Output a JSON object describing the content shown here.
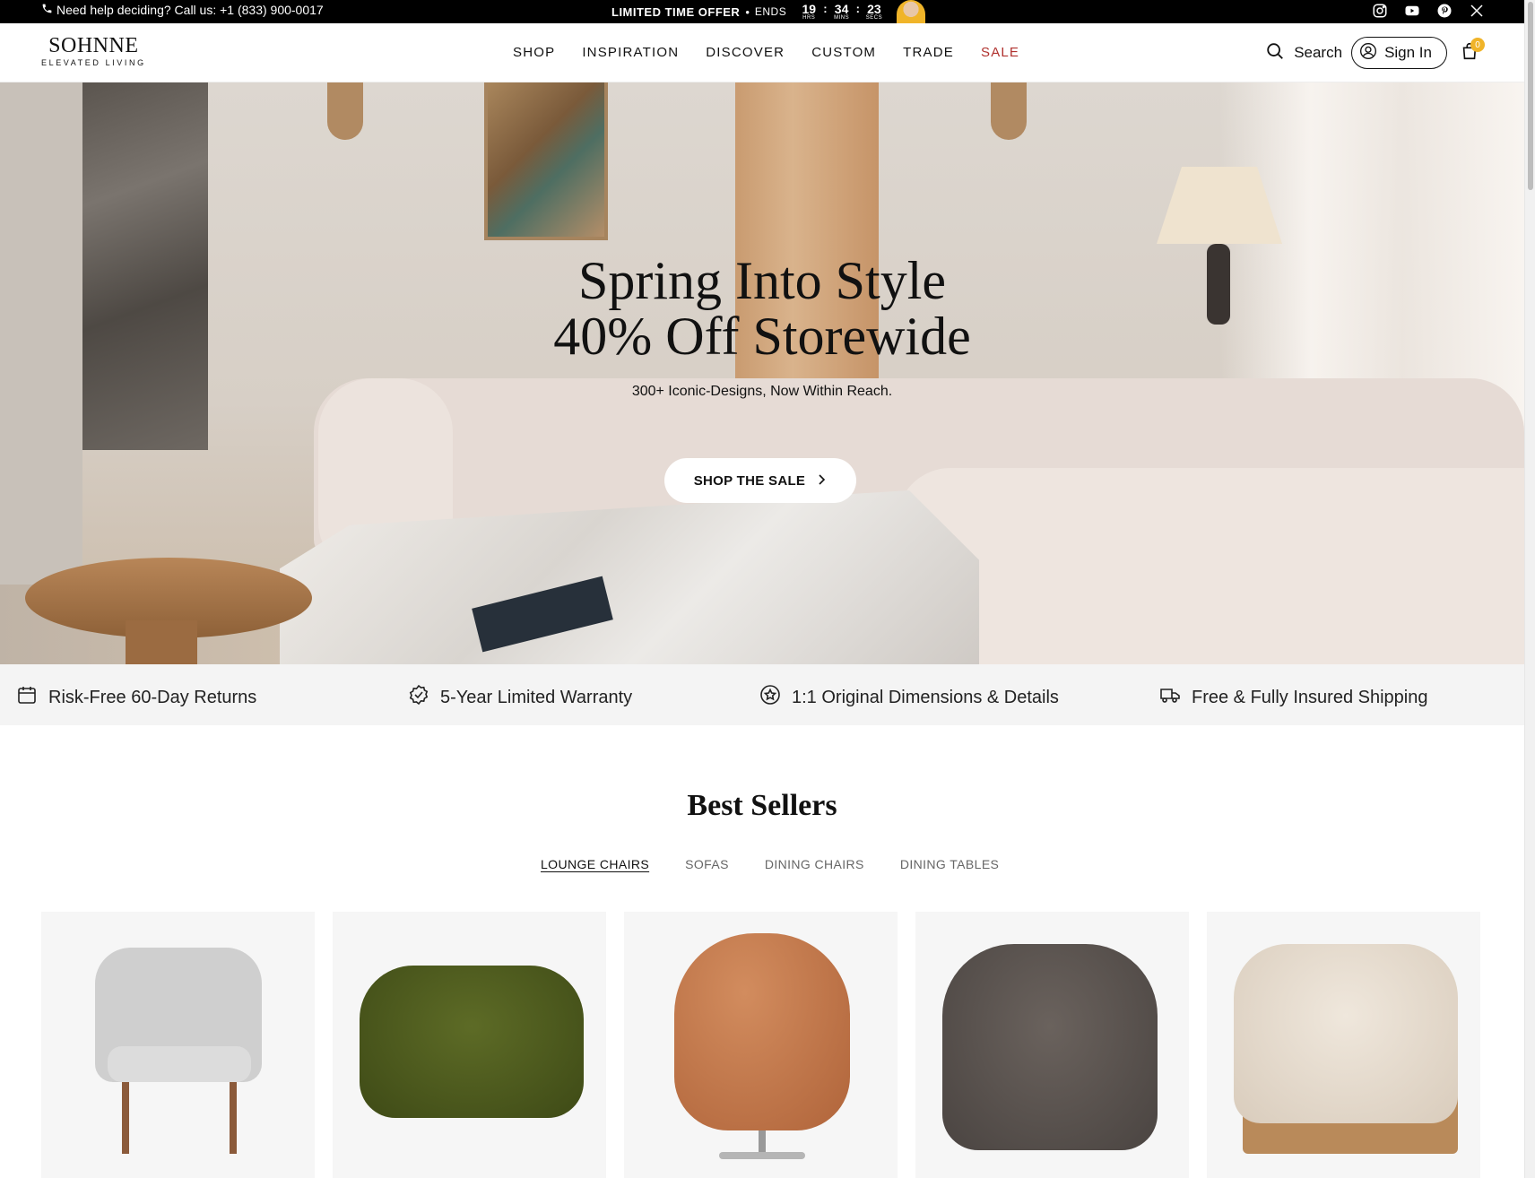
{
  "topbar": {
    "phone_text": "Need help deciding? Call us: +1 (833) 900-0017",
    "offer_label": "LIMITED TIME OFFER",
    "separator": "•",
    "ends_label": "ENDS",
    "timer": [
      {
        "value": "19",
        "unit": "HRS"
      },
      {
        "value": "34",
        "unit": "MINS"
      },
      {
        "value": "23",
        "unit": "SECS"
      }
    ],
    "timer_sep": ":",
    "social": [
      "instagram-icon",
      "youtube-icon",
      "pinterest-icon",
      "x-icon"
    ]
  },
  "header": {
    "brand": "SOHNNE",
    "tagline": "ELEVATED LIVING",
    "nav": [
      "SHOP",
      "INSPIRATION",
      "DISCOVER",
      "CUSTOM",
      "TRADE",
      "SALE"
    ],
    "sale_color": "#b0312e",
    "search_label": "Search",
    "signin_label": "Sign In",
    "cart_count": "0",
    "badge_color": "#f0b429"
  },
  "hero": {
    "title_line1": "Spring Into Style",
    "title_line2": "40% Off Storewide",
    "subtitle": "300+ Iconic-Designs, Now Within Reach.",
    "cta_label": "SHOP THE SALE"
  },
  "features": [
    {
      "icon": "calendar-icon",
      "label": "Risk-Free 60-Day Returns"
    },
    {
      "icon": "badge-check-icon",
      "label": "5-Year Limited Warranty"
    },
    {
      "icon": "star-badge-icon",
      "label": "1:1 Original Dimensions & Details"
    },
    {
      "icon": "truck-icon",
      "label": "Free & Fully Insured Shipping"
    }
  ],
  "best_sellers": {
    "title": "Best Sellers",
    "tabs": [
      "LOUNGE CHAIRS",
      "SOFAS",
      "DINING CHAIRS",
      "DINING TABLES"
    ],
    "active_tab": "LOUNGE CHAIRS"
  }
}
